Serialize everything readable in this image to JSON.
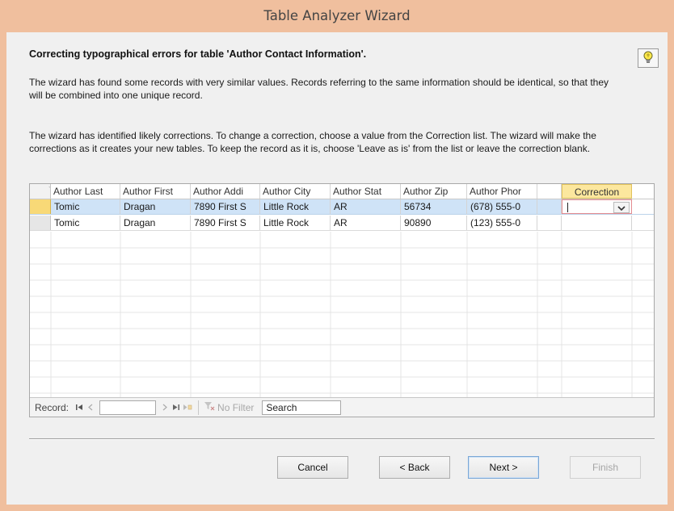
{
  "window": {
    "title": "Table Analyzer Wizard"
  },
  "heading": "Correcting typographical errors for table 'Author Contact Information'.",
  "paragraph1": "The wizard has found some records with very similar values. Records referring to the same information should be identical, so that they will be combined into one unique record.",
  "paragraph2": "The wizard has identified likely corrections. To change a correction, choose a value from the Correction list.  The wizard will make the corrections as it creates your new tables.  To keep the record as it is, choose 'Leave as is' from the list or leave the correction blank.",
  "hint_icon": "lightbulb-icon",
  "grid": {
    "columns": [
      "Author Last",
      "Author First",
      "Author Addi",
      "Author City",
      "Author Stat",
      "Author Zip",
      "Author Phor",
      "",
      "Correction"
    ],
    "rows": [
      [
        "Tomic",
        "Dragan",
        "7890 First S",
        "Little Rock",
        "AR",
        "56734",
        "(678) 555-0",
        "",
        ""
      ],
      [
        "Tomic",
        "Dragan",
        "7890 First S",
        "Little Rock",
        "AR",
        "90890",
        "(123) 555-0",
        "",
        ""
      ]
    ],
    "selected_row": 0
  },
  "navbar": {
    "record_label": "Record:",
    "record_value": "",
    "no_filter_label": "No Filter",
    "search_text": "Search"
  },
  "buttons": {
    "cancel": "Cancel",
    "back": "< Back",
    "next": "Next >",
    "finish": "Finish"
  },
  "colors": {
    "frame": "#f0bf9e",
    "selected_row": "#cfe3f7",
    "correction_header": "#fce79e",
    "record_selector_active": "#f8d977"
  }
}
